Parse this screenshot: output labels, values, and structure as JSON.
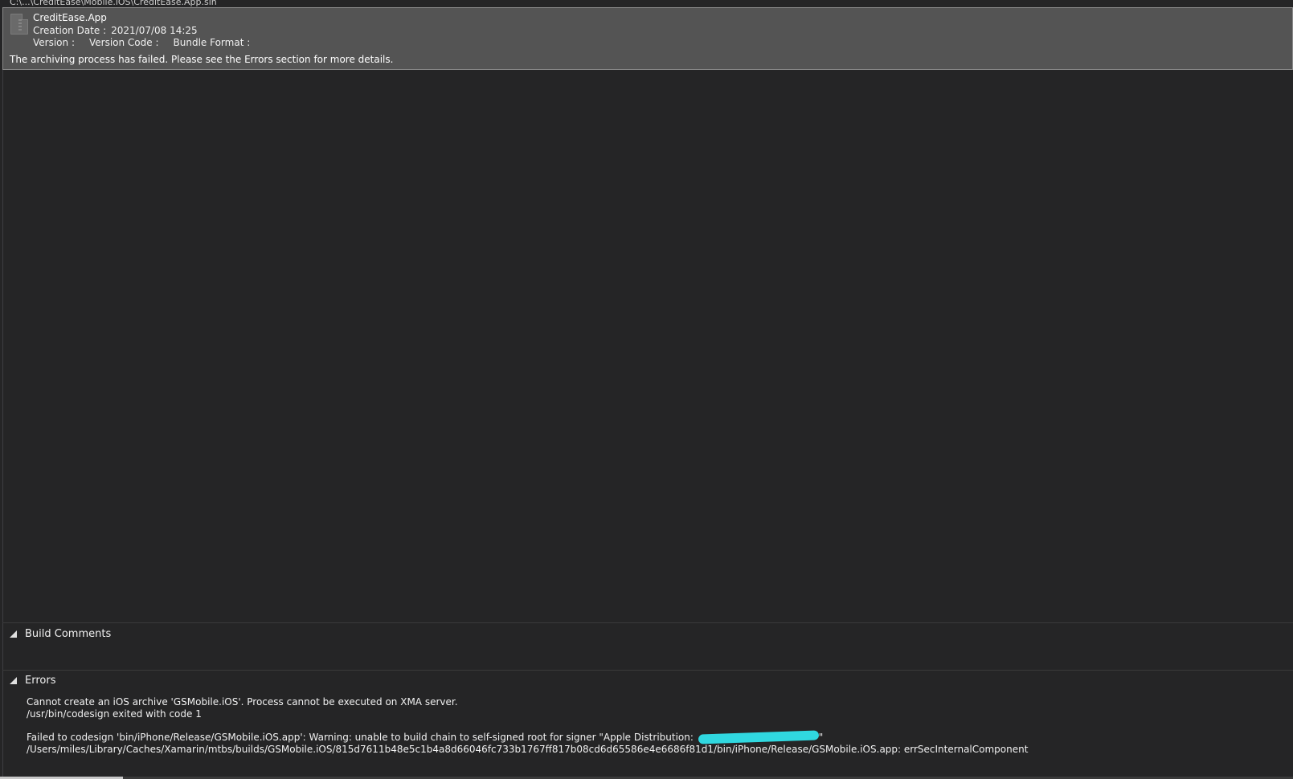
{
  "path_strip": "C:\\...\\CreditEase\\Mobile.iOS\\CreditEase.App.sln",
  "archive": {
    "name": "CreditEase.App",
    "creation_date_label": "Creation Date :",
    "creation_date_value": "2021/07/08 14:25",
    "version_label": "Version :",
    "version_code_label": "Version Code :",
    "bundle_format_label": "Bundle Format :",
    "status_message": "The archiving process has failed. Please see the Errors section for more details."
  },
  "sections": {
    "build_comments_label": "Build Comments",
    "errors_label": "Errors"
  },
  "errors": {
    "line1": "Cannot create an iOS archive 'GSMobile.iOS'. Process cannot be executed on XMA server.",
    "line2": "/usr/bin/codesign exited with code 1",
    "line3_prefix": "Failed to codesign 'bin/iPhone/Release/GSMobile.iOS.app': Warning: unable to build chain to self-signed root for signer \"Apple Distribution: ",
    "line3_suffix": "\"",
    "line4": "/Users/miles/Library/Caches/Xamarin/mtbs/builds/GSMobile.iOS/815d7611b48e5c1b4a8d66046fc733b1767ff817b08cd6d65586e4e6686f81d1/bin/iPhone/Release/GSMobile.iOS.app: errSecInternalComponent"
  },
  "colors": {
    "background": "#252526",
    "selected_row": "#545454",
    "redaction": "#30d8e0"
  }
}
